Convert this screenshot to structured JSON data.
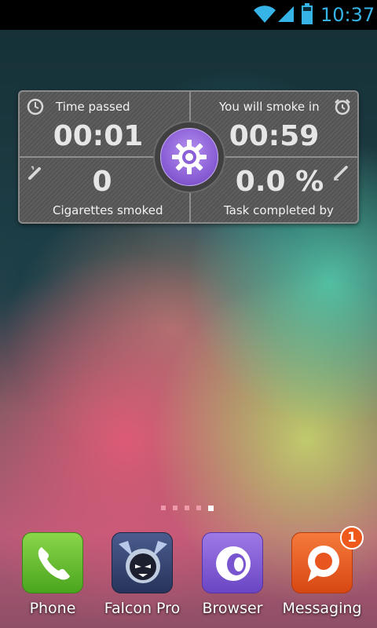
{
  "status_bar": {
    "time": "10:37",
    "icons": [
      "wifi-icon",
      "signal-icon",
      "battery-icon"
    ],
    "accent_color": "#36b4e8"
  },
  "widget": {
    "time_passed_label": "Time passed",
    "time_passed_value": "00:01",
    "next_smoke_label": "You will smoke in",
    "next_smoke_value": "00:59",
    "cigarettes_value": "0",
    "cigarettes_label": "Cigarettes smoked",
    "task_value": "0.0 %",
    "task_label": "Task completed by",
    "icons": [
      "clock-icon",
      "alarm-clock-icon",
      "cigarette-icon",
      "pencil-icon",
      "settings-gear-icon"
    ],
    "accent_color": "#8b5fd6"
  },
  "home": {
    "page_count": 5,
    "active_page": 5
  },
  "dock": {
    "apps": [
      {
        "label": "Phone",
        "icon": "phone-icon",
        "color": "#5cb82c"
      },
      {
        "label": "Falcon Pro",
        "icon": "falcon-icon",
        "color": "#3a4a7a"
      },
      {
        "label": "Browser",
        "icon": "browser-icon",
        "color": "#7a55d0"
      },
      {
        "label": "Messaging",
        "icon": "messaging-icon",
        "color": "#e8551e",
        "badge": "1"
      }
    ]
  }
}
